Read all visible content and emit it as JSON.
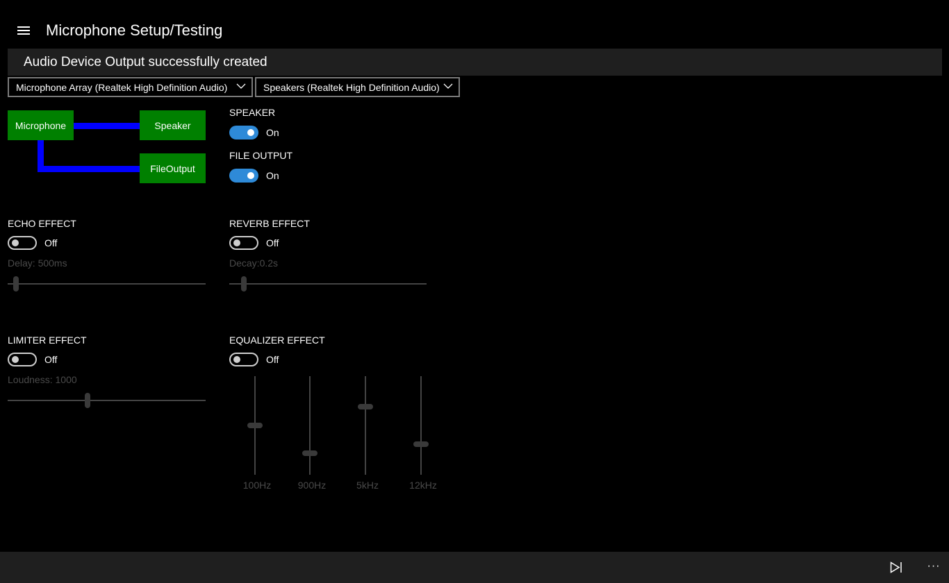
{
  "header": {
    "menu_icon": "hamburger-icon",
    "title": "Microphone Setup/Testing"
  },
  "status": {
    "message": "Audio Device Output successfully created"
  },
  "devices": {
    "input_device": "Microphone Array (Realtek High Definition Audio)",
    "output_device": "Speakers (Realtek High Definition Audio)",
    "chevron_icon": "chevron-down-icon"
  },
  "graph": {
    "nodes": {
      "microphone": "Microphone",
      "speaker": "Speaker",
      "file_output": "FileOutput"
    },
    "node_color": "#008000",
    "wire_color": "#0000ff"
  },
  "outputs": {
    "speaker": {
      "label": "SPEAKER",
      "state": "On",
      "enabled": true
    },
    "file_output": {
      "label": "FILE OUTPUT",
      "state": "On",
      "enabled": true
    }
  },
  "effects": {
    "echo": {
      "label": "ECHO EFFECT",
      "state": "Off",
      "enabled": false,
      "param_label": "Delay: 500ms",
      "slider_fraction": 0.03
    },
    "reverb": {
      "label": "REVERB EFFECT",
      "state": "Off",
      "enabled": false,
      "param_label": "Decay:0.2s",
      "slider_fraction": 0.06
    },
    "limiter": {
      "label": "LIMITER EFFECT",
      "state": "Off",
      "enabled": false,
      "param_label": "Loudness: 1000",
      "slider_fraction": 0.4
    },
    "equalizer": {
      "label": "EQUALIZER EFFECT",
      "state": "Off",
      "enabled": false,
      "bands": [
        {
          "label": "100Hz",
          "level_fraction": 0.5
        },
        {
          "label": "900Hz",
          "level_fraction": 0.2
        },
        {
          "label": "5kHz",
          "level_fraction": 0.7
        },
        {
          "label": "12kHz",
          "level_fraction": 0.3
        }
      ]
    }
  },
  "app_bar": {
    "next_icon": "skip-next-icon",
    "more_icon": "more-ellipsis-icon",
    "more_label": "···"
  },
  "colors": {
    "accent": "#2e8ad8",
    "background": "#000000",
    "bar_background": "#1f1f1f"
  }
}
